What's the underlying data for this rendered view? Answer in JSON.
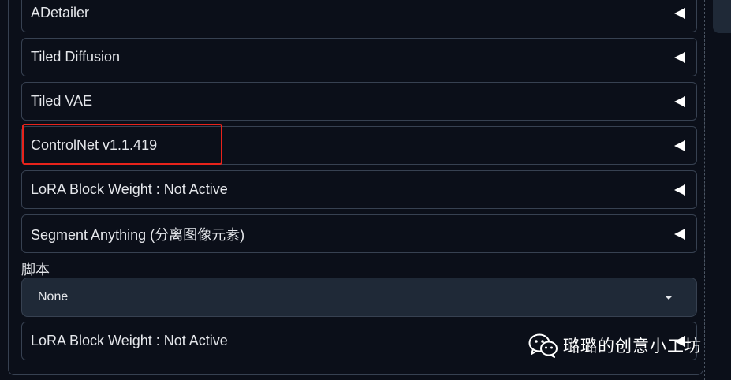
{
  "accordions": [
    {
      "label": "ADetailer"
    },
    {
      "label": "Tiled Diffusion"
    },
    {
      "label": "Tiled VAE"
    },
    {
      "label": "ControlNet v1.1.419"
    },
    {
      "label": "LoRA Block Weight : Not Active"
    },
    {
      "label": "Segment Anything (分离图像元素)"
    }
  ],
  "script": {
    "label": "脚本",
    "selected": "None"
  },
  "bottom_accordion": {
    "label": "LoRA Block Weight : Not Active"
  },
  "watermark": {
    "text": "璐璐的创意小工坊",
    "icon": "wechat-icon"
  },
  "colors": {
    "background": "#0b0f19",
    "border": "#374151",
    "dropdown_bg": "#1f2937",
    "highlight": "#e8231b",
    "text": "#e5e7eb"
  }
}
